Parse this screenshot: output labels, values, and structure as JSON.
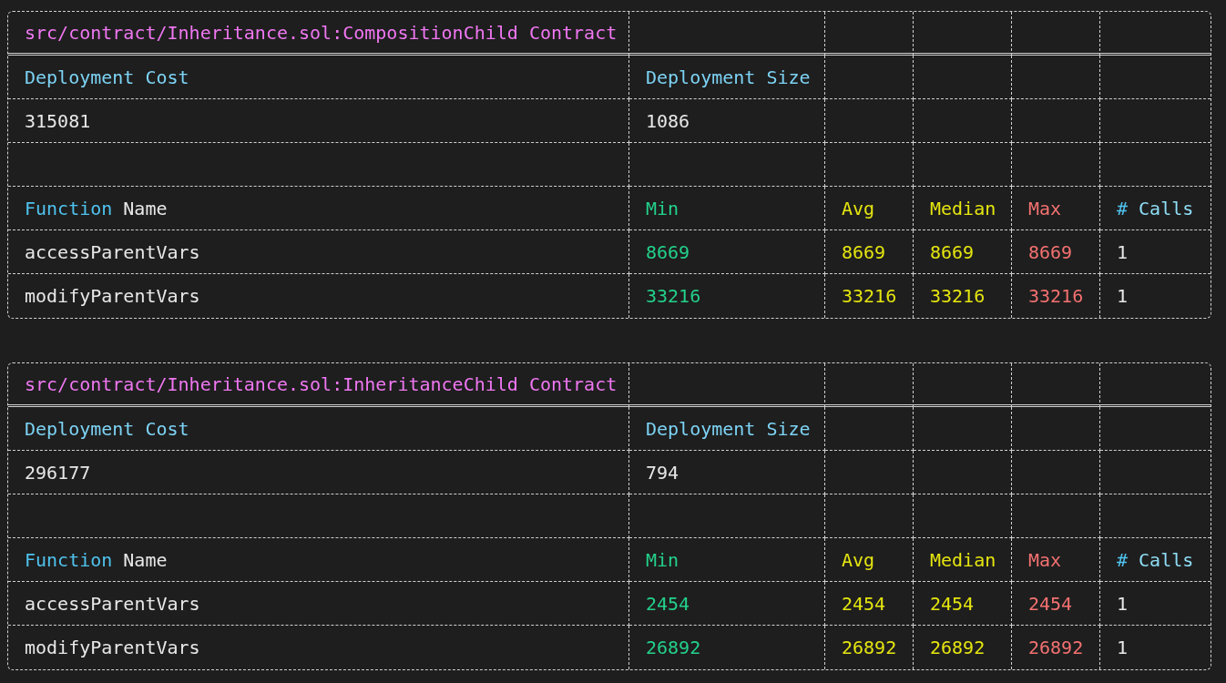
{
  "tables": [
    {
      "title": "src/contract/Inheritance.sol:CompositionChild Contract",
      "deployment_headers": [
        "Deployment Cost",
        "Deployment Size"
      ],
      "deployment_values": [
        "315081",
        "1086"
      ],
      "columns": [
        {
          "words": [
            {
              "text": "Function",
              "color": "#4fc3ee"
            },
            {
              "text": "Name",
              "color": "#e8e8e8"
            }
          ],
          "values": {
            "color": "#e8e8e8"
          }
        },
        {
          "words": [
            {
              "text": "Min",
              "color": "#23d18b"
            }
          ],
          "values": {
            "color": "#23d18b"
          }
        },
        {
          "words": [
            {
              "text": "Avg",
              "color": "#e5e510"
            }
          ],
          "values": {
            "color": "#e5e510"
          }
        },
        {
          "words": [
            {
              "text": "Median",
              "color": "#e5e510"
            }
          ],
          "values": {
            "color": "#e5e510"
          }
        },
        {
          "words": [
            {
              "text": "Max",
              "color": "#f47171"
            }
          ],
          "values": {
            "color": "#f47171"
          }
        },
        {
          "words": [
            {
              "text": "#",
              "color": "#4fc3ee"
            },
            {
              "text": "Calls",
              "color": "#8fdcf5"
            }
          ],
          "values": {
            "color": "#e8e8e8"
          }
        }
      ],
      "rows": [
        [
          "accessParentVars",
          "8669",
          "8669",
          "8669",
          "8669",
          "1"
        ],
        [
          "modifyParentVars",
          "33216",
          "33216",
          "33216",
          "33216",
          "1"
        ]
      ]
    },
    {
      "title": "src/contract/Inheritance.sol:InheritanceChild Contract",
      "deployment_headers": [
        "Deployment Cost",
        "Deployment Size"
      ],
      "deployment_values": [
        "296177",
        "794"
      ],
      "columns": [
        {
          "words": [
            {
              "text": "Function",
              "color": "#4fc3ee"
            },
            {
              "text": "Name",
              "color": "#e8e8e8"
            }
          ],
          "values": {
            "color": "#e8e8e8"
          }
        },
        {
          "words": [
            {
              "text": "Min",
              "color": "#23d18b"
            }
          ],
          "values": {
            "color": "#23d18b"
          }
        },
        {
          "words": [
            {
              "text": "Avg",
              "color": "#e5e510"
            }
          ],
          "values": {
            "color": "#e5e510"
          }
        },
        {
          "words": [
            {
              "text": "Median",
              "color": "#e5e510"
            }
          ],
          "values": {
            "color": "#e5e510"
          }
        },
        {
          "words": [
            {
              "text": "Max",
              "color": "#f47171"
            }
          ],
          "values": {
            "color": "#f47171"
          }
        },
        {
          "words": [
            {
              "text": "#",
              "color": "#4fc3ee"
            },
            {
              "text": "Calls",
              "color": "#8fdcf5"
            }
          ],
          "values": {
            "color": "#e8e8e8"
          }
        }
      ],
      "rows": [
        [
          "accessParentVars",
          "2454",
          "2454",
          "2454",
          "2454",
          "1"
        ],
        [
          "modifyParentVars",
          "26892",
          "26892",
          "26892",
          "26892",
          "1"
        ]
      ]
    }
  ]
}
